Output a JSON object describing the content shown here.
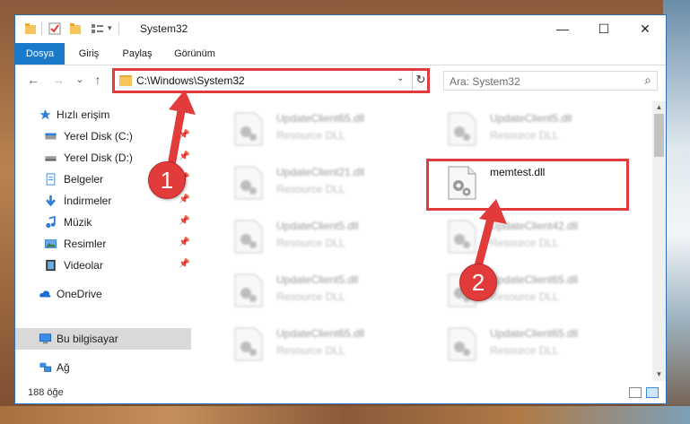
{
  "window": {
    "title": "System32",
    "controls": {
      "minimize": "—",
      "maximize": "☐",
      "close": "✕"
    }
  },
  "ribbon": {
    "tabs": [
      {
        "label": "Dosya",
        "active": true
      },
      {
        "label": "Giriş"
      },
      {
        "label": "Paylaş"
      },
      {
        "label": "Görünüm"
      }
    ]
  },
  "address": {
    "path": "C:\\Windows\\System32",
    "dropdown": "⌄",
    "refresh": "↻"
  },
  "search": {
    "placeholder": "Ara: System32",
    "icon": "⌕"
  },
  "nav_buttons": {
    "back": "←",
    "forward": "→",
    "recent": "⌄",
    "up": "↑"
  },
  "sidebar": {
    "items": [
      {
        "label": "Hızlı erişim",
        "icon": "star-icon"
      },
      {
        "label": "Yerel Disk (C:)",
        "icon": "drive-icon",
        "pinned": true
      },
      {
        "label": "Yerel Disk (D:)",
        "icon": "drive-icon",
        "pinned": true
      },
      {
        "label": "Belgeler",
        "icon": "documents-icon",
        "pinned": true
      },
      {
        "label": "İndirmeler",
        "icon": "download-icon",
        "pinned": true
      },
      {
        "label": "Müzik",
        "icon": "music-icon",
        "pinned": true
      },
      {
        "label": "Resimler",
        "icon": "pictures-icon",
        "pinned": true
      },
      {
        "label": "Videolar",
        "icon": "videos-icon",
        "pinned": true
      },
      {
        "label": "OneDrive",
        "icon": "cloud-icon"
      },
      {
        "label": "Bu bilgisayar",
        "icon": "computer-icon",
        "selected": true
      },
      {
        "label": "Ağ",
        "icon": "network-icon"
      }
    ]
  },
  "files": [
    {
      "name": "UpdateClient65.dll",
      "desc": "Resource DLL"
    },
    {
      "name": "UpdateClient5.dll",
      "desc": "Resource DLL"
    },
    {
      "name": "UpdateClient21.dll",
      "desc": "Resource DLL"
    },
    {
      "name": "memtest.dll",
      "desc": ""
    },
    {
      "name": "UpdateClient5.dll",
      "desc": "Resource DLL"
    },
    {
      "name": "UpdateClient42.dll",
      "desc": "Resource DLL"
    },
    {
      "name": "UpdateClient5.dll",
      "desc": "Resource DLL"
    },
    {
      "name": "UpdateClient65.dll",
      "desc": "Resource DLL"
    },
    {
      "name": "UpdateClient65.dll",
      "desc": "Resource DLL"
    },
    {
      "name": "UpdateClient65.dll",
      "desc": "Resource DLL"
    }
  ],
  "status": {
    "count": "188 öğe"
  },
  "annotations": {
    "badge1": "1",
    "badge2": "2"
  },
  "colors": {
    "accent": "#1979ca",
    "highlight": "#e23b3b",
    "selected": "#d9d9d9"
  }
}
